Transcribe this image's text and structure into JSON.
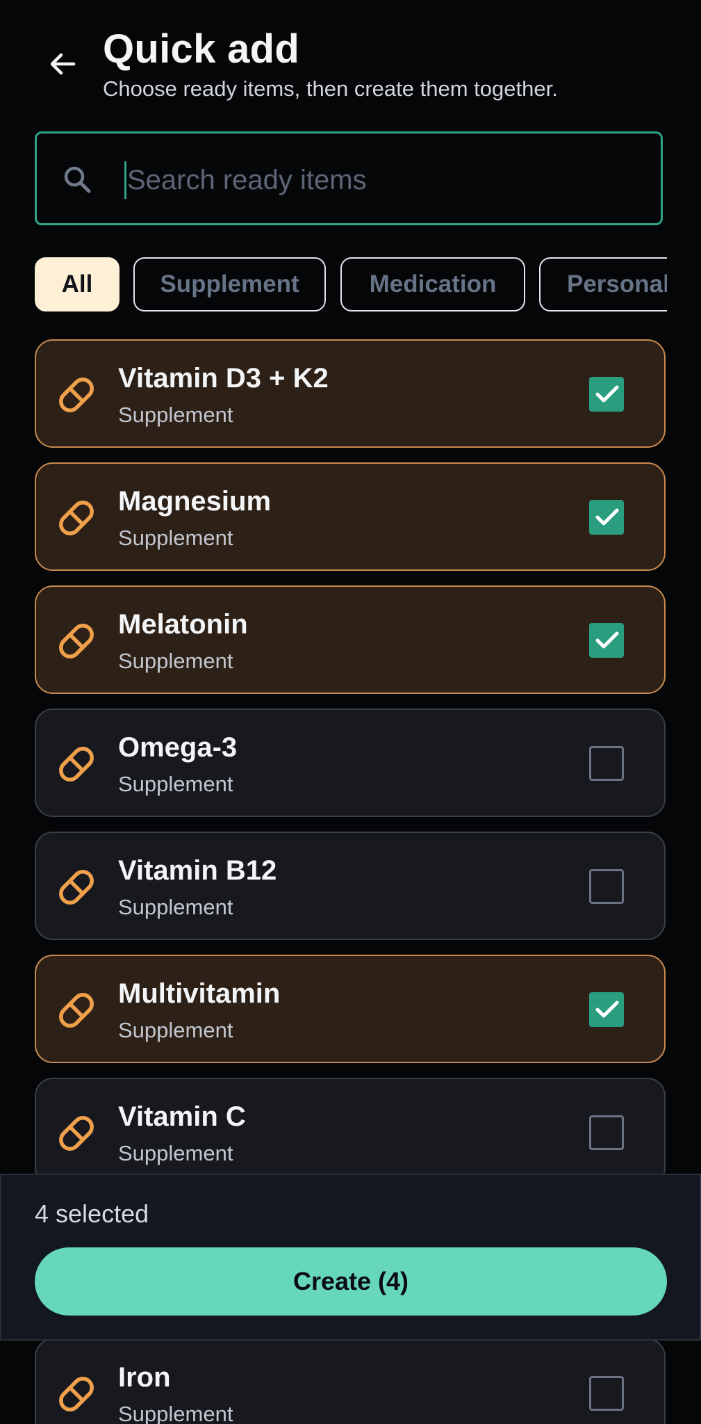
{
  "header": {
    "title": "Quick add",
    "subtitle": "Choose ready items, then create them together."
  },
  "search": {
    "placeholder": "Search ready items",
    "value": ""
  },
  "filters": [
    {
      "label": "All",
      "active": true
    },
    {
      "label": "Supplement",
      "active": false
    },
    {
      "label": "Medication",
      "active": false
    },
    {
      "label": "Personal",
      "active": false
    }
  ],
  "items": [
    {
      "name": "Vitamin D3 + K2",
      "category": "Supplement",
      "selected": true
    },
    {
      "name": "Magnesium",
      "category": "Supplement",
      "selected": true
    },
    {
      "name": "Melatonin",
      "category": "Supplement",
      "selected": true
    },
    {
      "name": "Omega-3",
      "category": "Supplement",
      "selected": false
    },
    {
      "name": "Vitamin B12",
      "category": "Supplement",
      "selected": false
    },
    {
      "name": "Multivitamin",
      "category": "Supplement",
      "selected": true
    },
    {
      "name": "Vitamin C",
      "category": "Supplement",
      "selected": false
    },
    {
      "name": "Iron",
      "category": "Supplement",
      "selected": false
    }
  ],
  "footer": {
    "selected_label": "4 selected",
    "create_label": "Create (4)"
  },
  "icons": {
    "back": "arrow-left-icon",
    "search": "search-icon",
    "item": "pill-icon",
    "check": "check-icon"
  },
  "colors": {
    "accent": "#2fa488",
    "selected_border": "#c98a50",
    "selected_bg": "#2c2017",
    "pill": "#f0a04b",
    "create_button": "#66d6bd",
    "active_chip": "#fdf0d7"
  }
}
